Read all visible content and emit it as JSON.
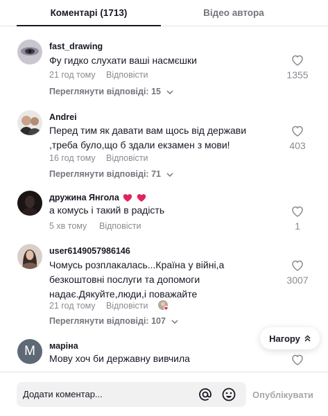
{
  "tabs": {
    "comments_label": "Коментарі (1713)",
    "author_videos_label": "Відео автора"
  },
  "comments": [
    {
      "author": "fast_drawing",
      "text": "Фу гидко слухати ваші насмєшки",
      "time": "21 год тому",
      "reply_label": "Відповісти",
      "view_replies": "Переглянути відповіді: 15",
      "likes": "1355"
    },
    {
      "author": "Andrei",
      "text": "Перед тим як давати вам щось від держави ,треба було,що б здали екзамен з мови!",
      "time": "16 год тому",
      "reply_label": "Відповісти",
      "view_replies": "Переглянути відповіді: 71",
      "likes": "403"
    },
    {
      "author": "дружина Янгола",
      "text": "а комусь і такий в радість",
      "time": "5 хв тому",
      "reply_label": "Відповісти",
      "likes": "1"
    },
    {
      "author": "user6149057986146",
      "text": "Чомусь розплакалась...Країна у війні,а безкоштовні послуги та допомоги надає.Дякуйте,люди,і поважайте",
      "time": "21 год тому",
      "reply_label": "Відповісти",
      "view_replies": "Переглянути відповіді: 107",
      "likes": "3007"
    },
    {
      "author": "маріна",
      "avatar_letter": "M",
      "text": "Мову хоч би державну вивчила"
    }
  ],
  "to_top_label": "Нагору",
  "composer": {
    "placeholder": "Додати коментар...",
    "publish_label": "Опублікувати"
  },
  "colors": {
    "like_heart_emoji": "#e0245e",
    "muted_text": "#8a8b91",
    "composer_bg": "#f1f1f2"
  }
}
